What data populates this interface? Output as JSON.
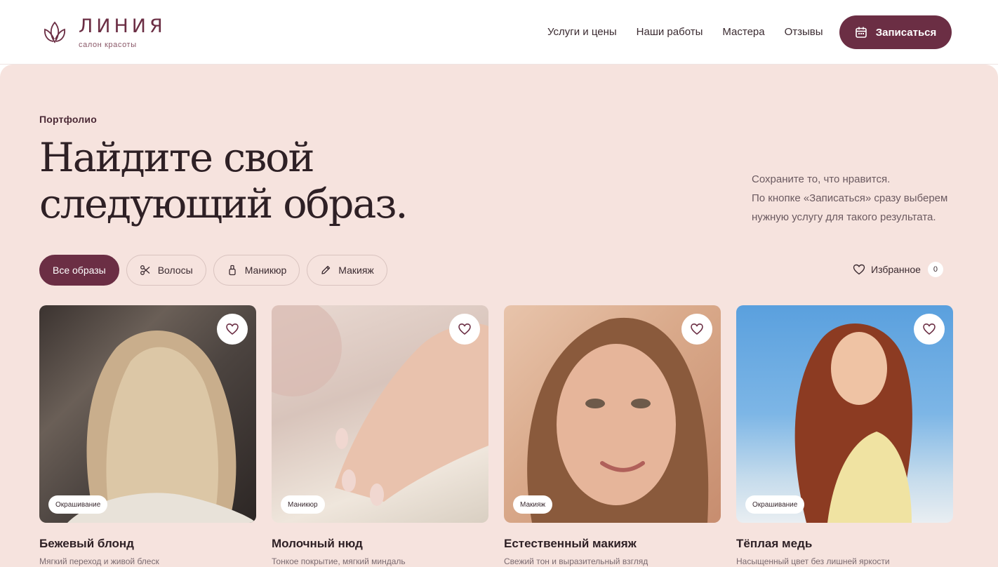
{
  "header": {
    "logo_name": "ЛИНИЯ",
    "logo_sub": "салон красоты",
    "nav": [
      "Услуги и цены",
      "Наши работы",
      "Мастера",
      "Отзывы"
    ],
    "cta_label": "Записаться"
  },
  "hero": {
    "eyebrow": "Портфолио",
    "title_line1": "Найдите свой",
    "title_line2": "следующий образ.",
    "intro_line1": "Сохраните то, что нравится.",
    "intro_line2": "По кнопке «Записаться» сразу выберем",
    "intro_line3": "нужную услугу для такого результата."
  },
  "filters": {
    "items": [
      {
        "label": "Все образы",
        "icon": "",
        "active": true
      },
      {
        "label": "Волосы",
        "icon": "scissors-icon",
        "active": false
      },
      {
        "label": "Маникюр",
        "icon": "nail-polish-icon",
        "active": false
      },
      {
        "label": "Макияж",
        "icon": "pencil-icon",
        "active": false
      }
    ],
    "favorites_label": "Избранное",
    "favorites_count": "0"
  },
  "cards": [
    {
      "tag": "Окрашивание",
      "title": "Бежевый блонд",
      "desc": "Мягкий переход и живой блеск"
    },
    {
      "tag": "Маникюр",
      "title": "Молочный нюд",
      "desc": "Тонкое покрытие, мягкий миндаль"
    },
    {
      "tag": "Макияж",
      "title": "Естественный макияж",
      "desc": "Свежий тон и выразительный взгляд"
    },
    {
      "tag": "Окрашивание",
      "title": "Тёплая медь",
      "desc": "Насыщенный цвет без лишней яркости"
    }
  ],
  "colors": {
    "brand": "#6b2e44",
    "panel_bg": "#f6e3de",
    "text_dark": "#2e2025"
  }
}
